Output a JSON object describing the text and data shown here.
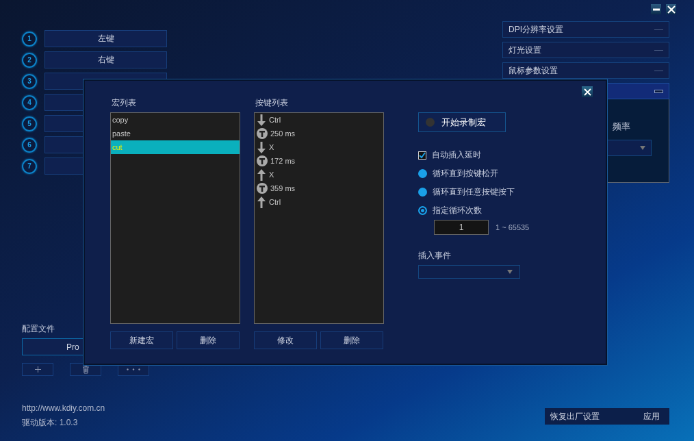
{
  "buttons": [
    {
      "number": "1",
      "label": "左键"
    },
    {
      "number": "2",
      "label": "右键"
    },
    {
      "number": "3"
    },
    {
      "number": "4"
    },
    {
      "number": "5"
    },
    {
      "number": "6"
    },
    {
      "number": "7"
    }
  ],
  "profile": {
    "title": "配置文件",
    "current": "Pro"
  },
  "footer": {
    "url": "http://www.kdiy.com.cn",
    "version": "驱动版本: 1.0.3"
  },
  "panels": [
    {
      "title": "DPI分辨率设置",
      "expanded": false
    },
    {
      "title": "灯光设置",
      "expanded": false
    },
    {
      "title": "鼠标参数设置",
      "expanded": false
    },
    {
      "expanded": true,
      "content_label": "频率"
    }
  ],
  "bottom_buttons": [
    "恢复出厂设置",
    "应用"
  ],
  "dialog": {
    "macro_list": {
      "title": "宏列表",
      "items": [
        {
          "label": "copy",
          "selected": false
        },
        {
          "label": "paste",
          "selected": false
        },
        {
          "label": "cut",
          "selected": true
        }
      ],
      "buttons": [
        "新建宏",
        "删除"
      ]
    },
    "key_list": {
      "title": "按键列表",
      "items": [
        {
          "kind": "down",
          "text": "Ctrl"
        },
        {
          "kind": "delay",
          "text": "250 ms"
        },
        {
          "kind": "down",
          "text": "X"
        },
        {
          "kind": "delay",
          "text": "172 ms"
        },
        {
          "kind": "up",
          "text": "X"
        },
        {
          "kind": "delay",
          "text": "359 ms"
        },
        {
          "kind": "up",
          "text": "Ctrl"
        }
      ],
      "buttons": [
        "修改",
        "删除"
      ]
    },
    "record_button": "开始录制宏",
    "auto_delay": {
      "label": "自动插入延时",
      "checked": true
    },
    "loop_options": [
      {
        "label": "循环直到按键松开",
        "selected": false
      },
      {
        "label": "循环直到任意按键按下",
        "selected": false
      },
      {
        "label": "指定循环次数",
        "selected": true
      }
    ],
    "loop_count": {
      "value": "1",
      "range": "1 ~ 65535"
    },
    "insert_event": {
      "title": "插入事件"
    }
  }
}
